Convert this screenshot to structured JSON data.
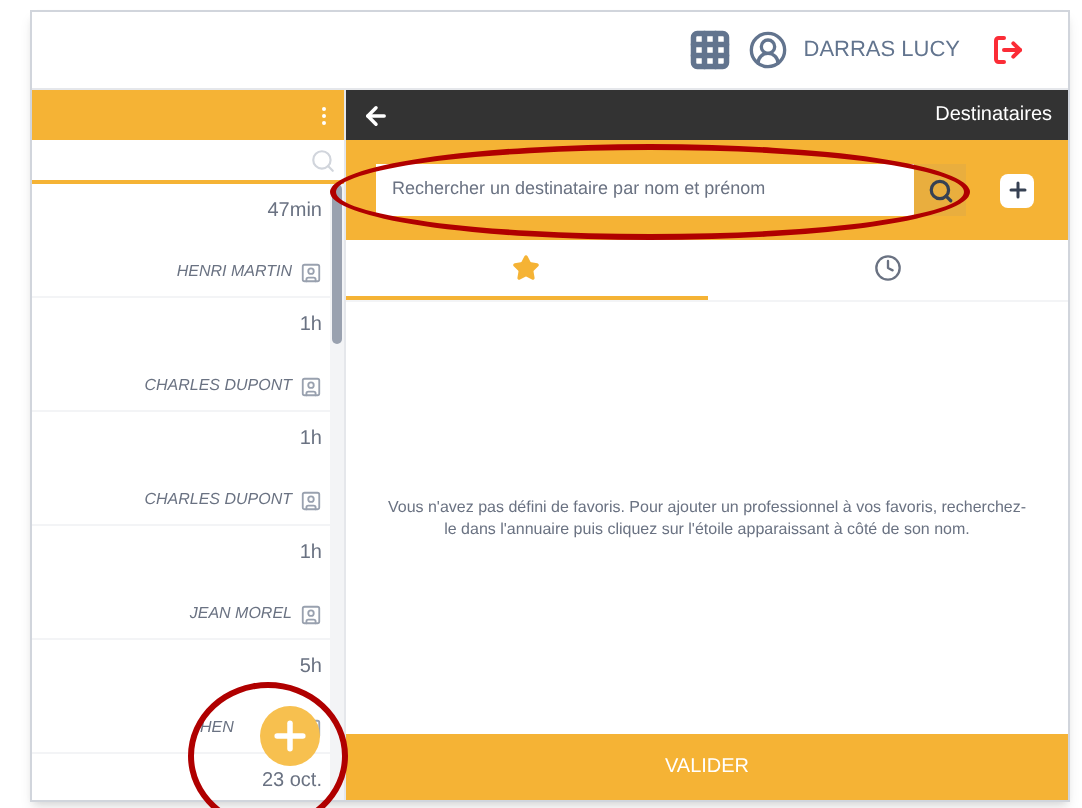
{
  "header": {
    "user": "DARRAS LUCY"
  },
  "left_panel": {
    "items": [
      {
        "time": "47min",
        "name": "HENRI MARTIN"
      },
      {
        "time": "1h",
        "name": "CHARLES DUPONT"
      },
      {
        "time": "1h",
        "name": "CHARLES DUPONT"
      },
      {
        "time": "1h",
        "name": "JEAN MOREL"
      },
      {
        "time": "5h",
        "name": "HEN"
      },
      {
        "time": "23 oct."
      }
    ]
  },
  "right_panel": {
    "title": "Destinataires",
    "search": {
      "placeholder": "Rechercher un destinataire par nom et prénom"
    },
    "tabs": [
      {
        "kind": "favorites",
        "selected": true
      },
      {
        "kind": "recent",
        "selected": false
      }
    ],
    "message": "Vous n'avez pas défini de favoris. Pour ajouter un professionnel à vos favoris, recherchez-le dans l'annuaire puis cliquez sur l'étoile apparaissant à côté de son nom.",
    "button": "VALIDER"
  }
}
